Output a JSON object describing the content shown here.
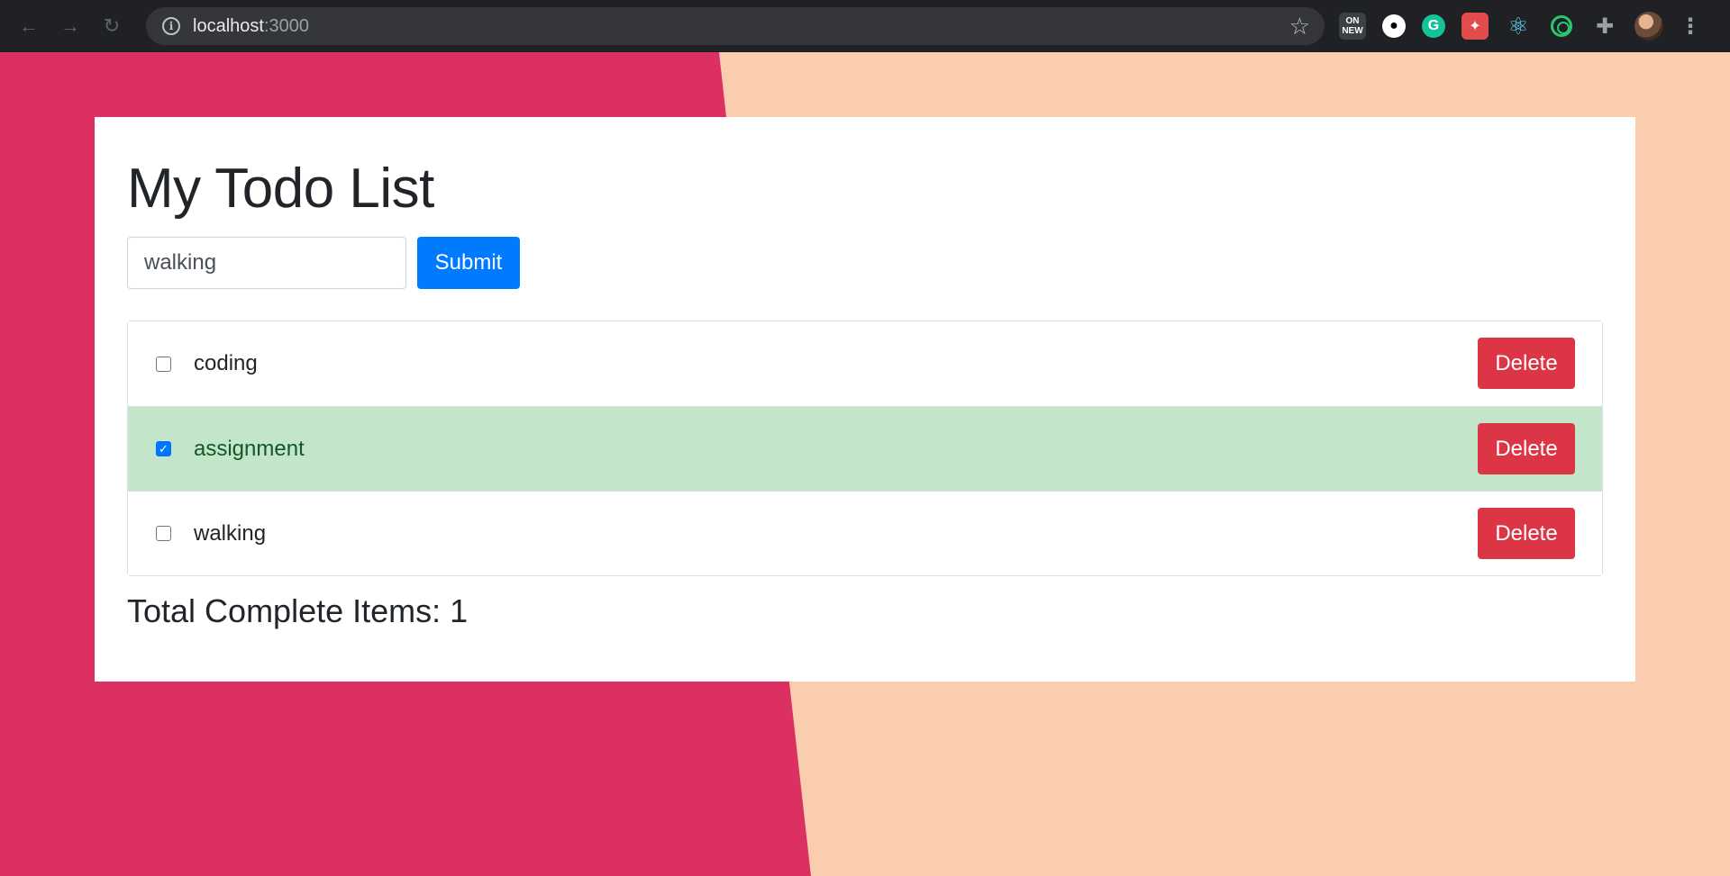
{
  "browser": {
    "url_host": "localhost",
    "url_port": ":3000",
    "back_icon": "←",
    "forward_icon": "→",
    "reload_icon": "↻",
    "info_icon": "i",
    "star_icon": "☆",
    "ext_new_top": "ON",
    "ext_new_label": "NEW",
    "ext_github_icon": "●",
    "ext_grammarly_icon": "G",
    "ext_red_icon": "✦",
    "ext_react_icon": "⚛",
    "ext_puzzle_icon": "✚",
    "menu_icon": "⋮"
  },
  "colors": {
    "page_bg_left": "#dc3062",
    "page_bg_right": "#f9cdae",
    "primary": "#007bff",
    "danger": "#dc3545",
    "success_bg": "#c3e6cb"
  },
  "app": {
    "title": "My Todo List",
    "input_value": "walking",
    "submit_label": "Submit",
    "items": [
      {
        "label": "coding",
        "checked": false,
        "delete_label": "Delete"
      },
      {
        "label": "assignment",
        "checked": true,
        "delete_label": "Delete"
      },
      {
        "label": "walking",
        "checked": false,
        "delete_label": "Delete"
      }
    ],
    "total_label": "Total Complete Items: 1",
    "check_mark": "✓"
  }
}
